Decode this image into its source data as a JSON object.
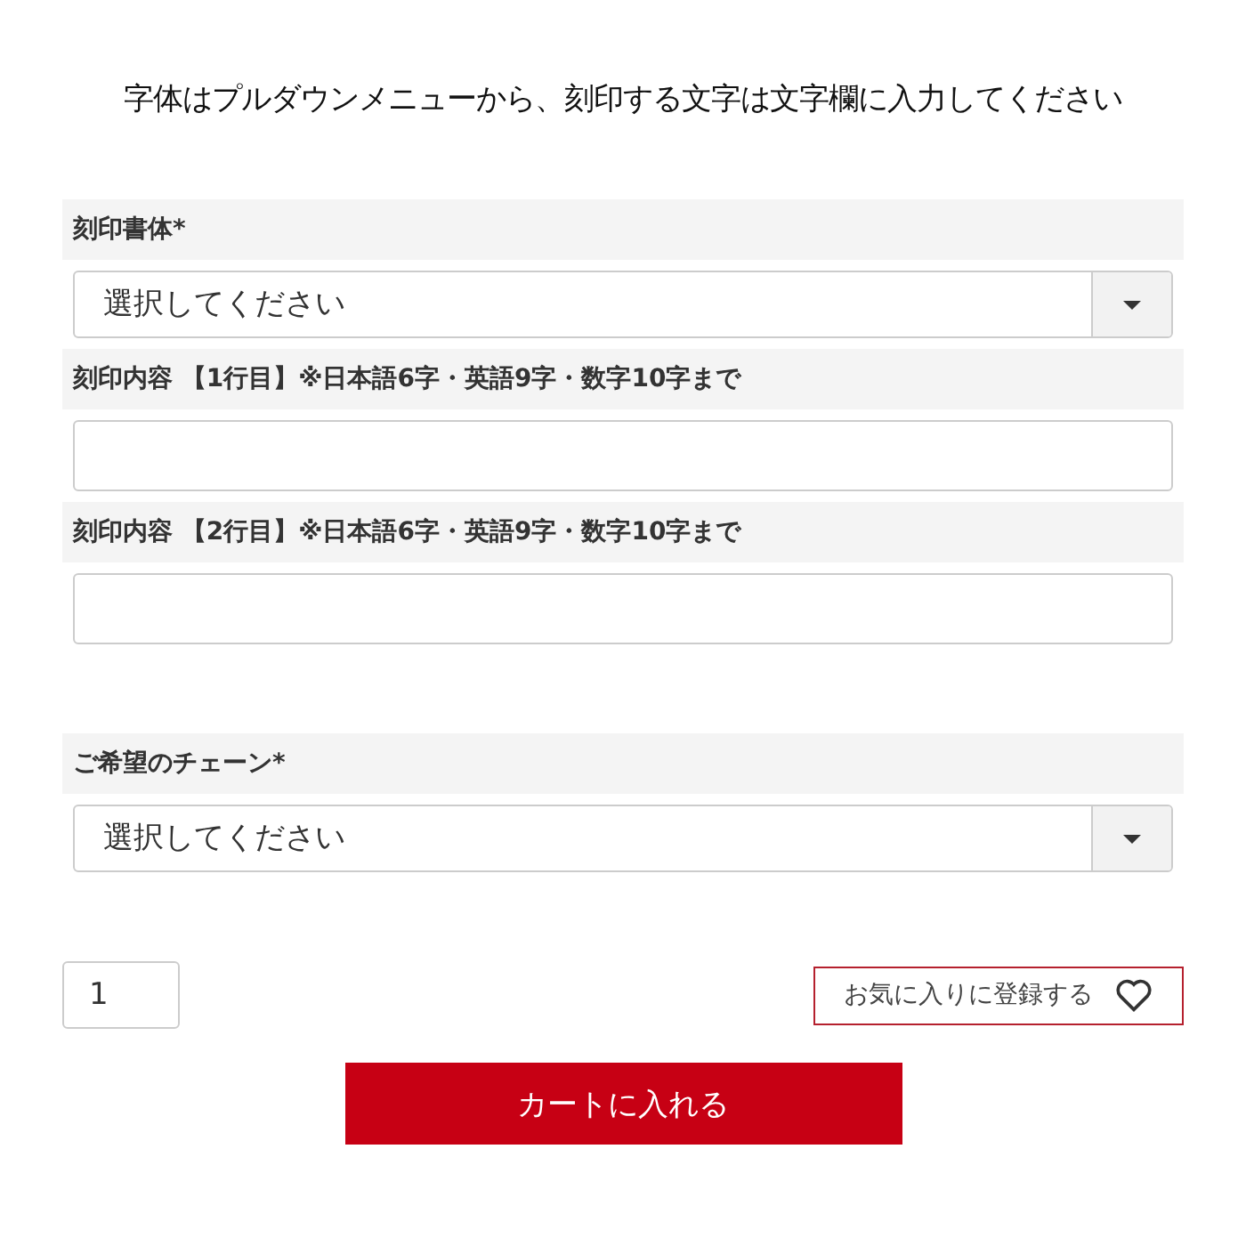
{
  "instruction": "字体はプルダウンメニューから、刻印する文字は文字欄に入力してください",
  "sections": [
    {
      "fields": [
        {
          "kind": "select",
          "label": "刻印書体*",
          "value": "選択してください"
        },
        {
          "kind": "text",
          "label": "刻印内容 【1行目】※日本語6字・英語9字・数字10字まで"
        },
        {
          "kind": "text",
          "label": "刻印内容 【2行目】※日本語6字・英語9字・数字10字まで"
        }
      ]
    },
    {
      "fields": [
        {
          "kind": "select",
          "label": "ご希望のチェーン*",
          "value": "選択してください"
        }
      ]
    }
  ],
  "quantity": "1",
  "favorite_button": "お気に入りに登録する",
  "cart_button": "カートに入れる"
}
